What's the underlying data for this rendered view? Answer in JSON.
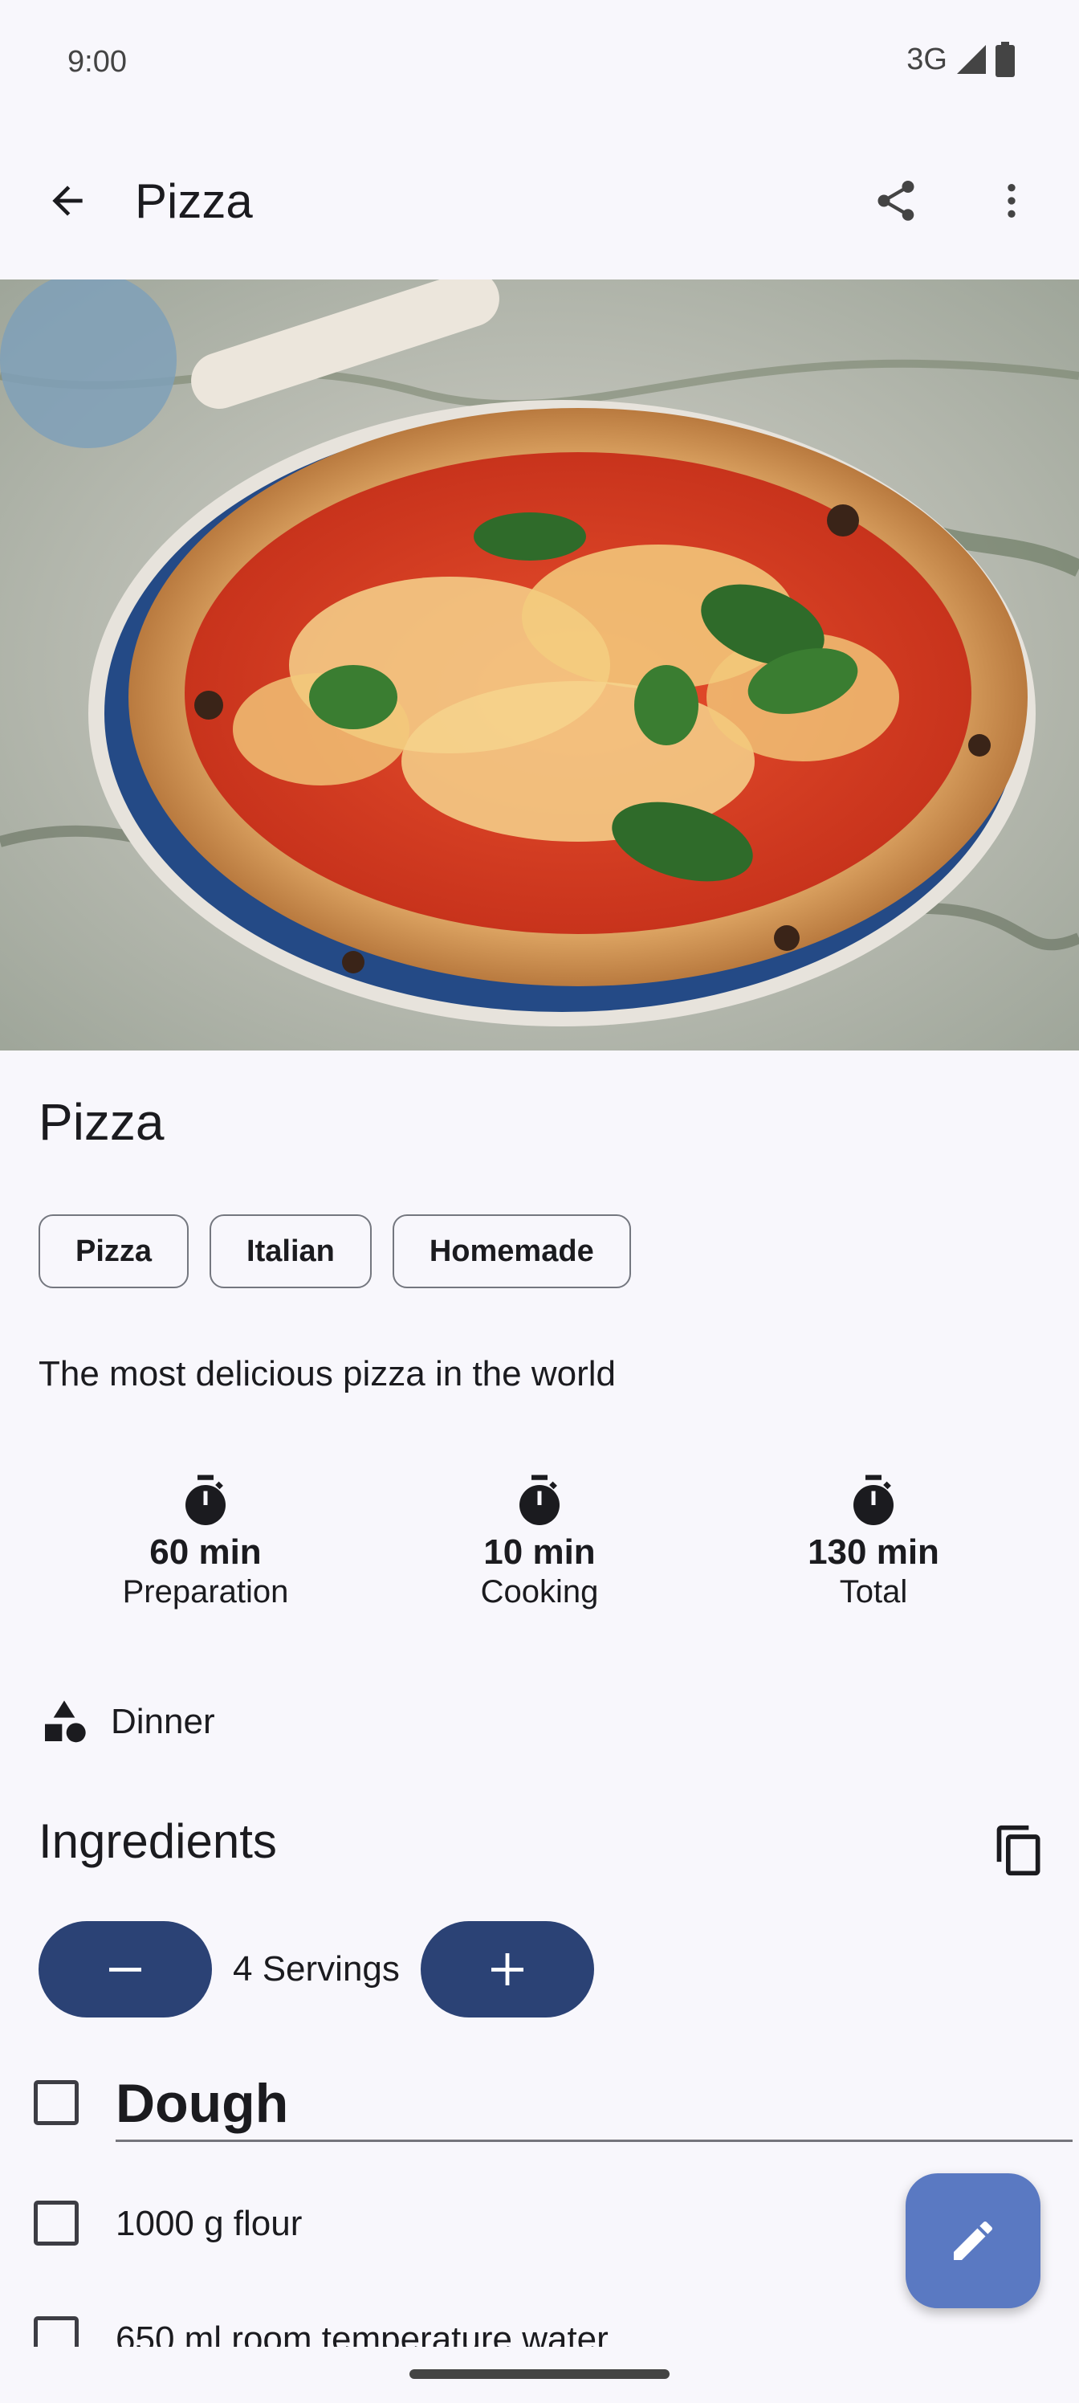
{
  "status_bar": {
    "time": "9:00",
    "network": "3G"
  },
  "app_bar": {
    "title": "Pizza",
    "icons": [
      "back-arrow-icon",
      "share-icon",
      "more-vert-icon"
    ]
  },
  "recipe": {
    "title": "Pizza",
    "tags": [
      "Pizza",
      "Italian",
      "Homemade"
    ],
    "description": "The most delicious pizza in the world",
    "times": [
      {
        "value": "60 min",
        "label": "Preparation"
      },
      {
        "value": "10 min",
        "label": "Cooking"
      },
      {
        "value": "130 min",
        "label": "Total"
      }
    ],
    "category": "Dinner"
  },
  "ingredients": {
    "title": "Ingredients",
    "servings_label": "4 Servings",
    "groups": [
      {
        "title": "Dough",
        "items": [
          "1000 g flour",
          "650 ml room temperature water"
        ]
      }
    ]
  },
  "colors": {
    "accent": "#2b4275",
    "fab": "#5a79c2",
    "background": "#f8f7fc"
  }
}
